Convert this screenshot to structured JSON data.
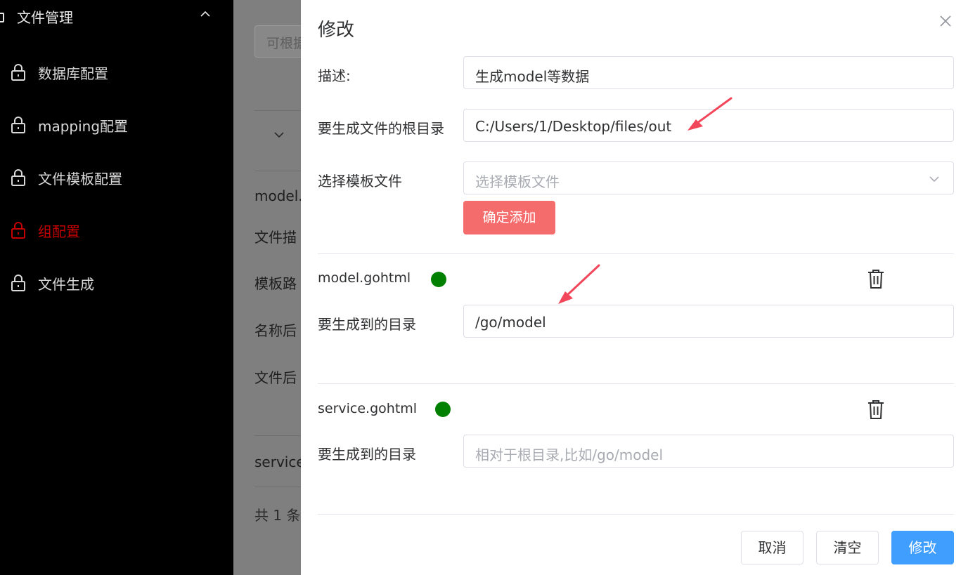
{
  "sidebar": {
    "group": {
      "label": "文件管理"
    },
    "items": [
      {
        "label": "数据库配置",
        "active": false
      },
      {
        "label": "mapping配置",
        "active": false
      },
      {
        "label": "文件模板配置",
        "active": false
      },
      {
        "label": "组配置",
        "active": true
      },
      {
        "label": "文件生成",
        "active": false
      }
    ]
  },
  "background_page": {
    "search_placeholder": "可根据",
    "row_texts": [
      "model.",
      "文件描",
      "模板路",
      "名称后",
      "文件后",
      "service"
    ],
    "pagination_text": "共 1 条"
  },
  "drawer": {
    "title": "修改",
    "fields": {
      "description": {
        "label": "描述:",
        "value": "生成model等数据"
      },
      "root_dir": {
        "label": "要生成文件的根目录",
        "value": "C:/Users/1/Desktop/files/out"
      },
      "template_select": {
        "label": "选择模板文件",
        "placeholder": "选择模板文件"
      }
    },
    "add_button": "确定添加",
    "templates": [
      {
        "name": "model.gohtml",
        "dir_label": "要生成到的目录",
        "dir_value": "/go/model",
        "dir_placeholder": ""
      },
      {
        "name": "service.gohtml",
        "dir_label": "要生成到的目录",
        "dir_value": "",
        "dir_placeholder": "相对于根目录,比如/go/model"
      }
    ],
    "footer": {
      "cancel": "取消",
      "clear": "清空",
      "submit": "修改"
    }
  },
  "colors": {
    "sidebar_bg": "#000000",
    "active_item": "#c40000",
    "add_button": "#f56c6c",
    "primary": "#409eff",
    "status_dot": "#008000",
    "annotation_arrow": "#f2475a"
  }
}
